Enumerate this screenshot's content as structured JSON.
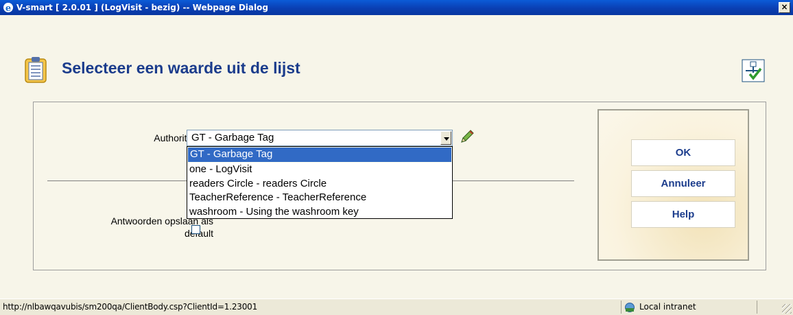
{
  "window": {
    "title": "V-smart [ 2.0.01 ] (LogVisit - bezig) -- Webpage Dialog",
    "close_label": "×"
  },
  "page": {
    "title": "Selecteer een waarde uit de lijst"
  },
  "form": {
    "authority_label": "AuthorityTable",
    "authority_value": "GT - Garbage Tag",
    "options": [
      "GT - Garbage Tag",
      "one - LogVisit",
      "readers Circle - readers Circle",
      "TeacherReference - TeacherReference",
      "washroom - Using the washroom key"
    ],
    "default_label_line1": "Antwoorden opslaan als",
    "default_label_line2": "default",
    "default_checked": false
  },
  "buttons": {
    "ok": "OK",
    "cancel": "Annuleer",
    "help": "Help"
  },
  "statusbar": {
    "url": "http://nlbawqavubis/sm200qa/ClientBody.csp?ClientId=1.23001",
    "zone": "Local intranet"
  },
  "icons": {
    "browser": "ie-icon",
    "page": "clipboard-icon",
    "workflow": "workflow-icon",
    "edit": "pencil-icon",
    "zone": "intranet-icon"
  },
  "colors": {
    "title_blue": "#1b3c8c",
    "selection": "#316ac5",
    "titlebar": "#0a3fb3"
  }
}
